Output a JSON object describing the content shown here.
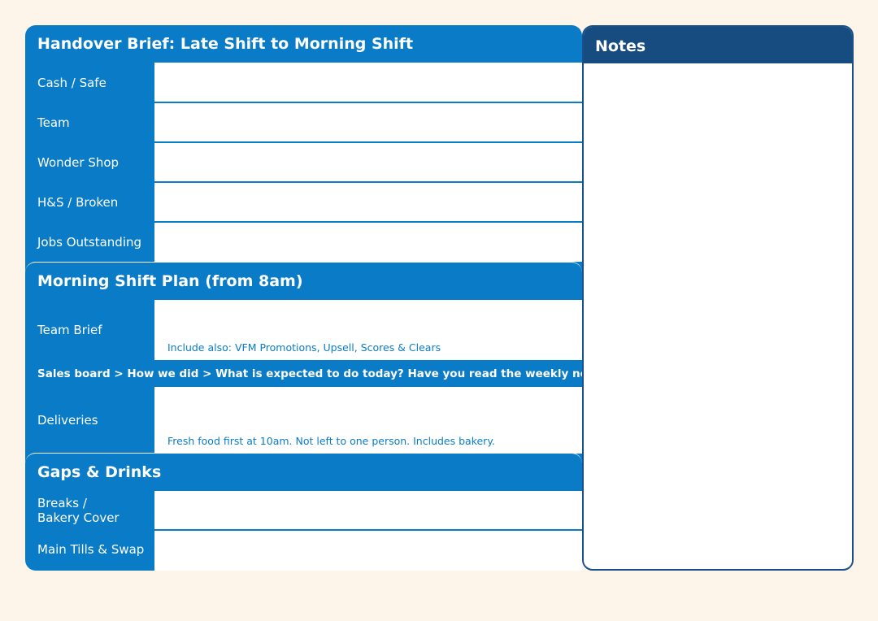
{
  "handover": {
    "title": "Handover Brief: Late Shift to Morning Shift",
    "rows": [
      {
        "label": "Cash / Safe"
      },
      {
        "label": "Team"
      },
      {
        "label": "Wonder Shop"
      },
      {
        "label": "H&S / Broken"
      },
      {
        "label": "Jobs Outstanding"
      }
    ]
  },
  "morning": {
    "title": "Morning Shift Plan (from 8am)",
    "team_brief": {
      "label": "Team Brief",
      "hint": "Include also: VFM Promotions, Upsell, Scores & Clears"
    },
    "sales_board": "Sales board  >  How we did  >  What is expected to do today?  Have you read the weekly news?",
    "deliveries": {
      "label": "Deliveries",
      "hint": "Fresh food first at 10am. Not left to one person. Includes bakery."
    }
  },
  "gaps": {
    "title": "Gaps & Drinks",
    "rows": [
      {
        "label_line1": "Breaks /",
        "label_line2": "Bakery Cover"
      },
      {
        "label": "Main Tills & Swap"
      }
    ]
  },
  "notes": {
    "title": "Notes"
  },
  "colors": {
    "primary": "#0a7cc7",
    "notes_header": "#174c80",
    "background": "#fdf5ea"
  }
}
